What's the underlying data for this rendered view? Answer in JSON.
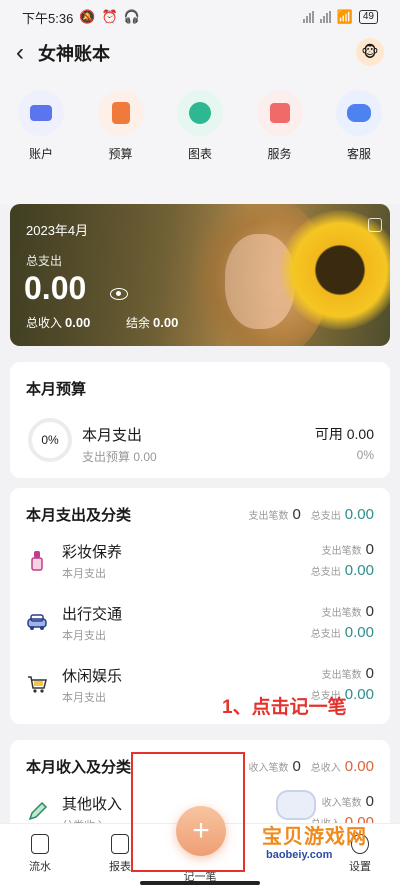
{
  "status": {
    "time": "下午5:36",
    "battery": "49"
  },
  "header": {
    "title": "女神账本"
  },
  "quick_actions": [
    {
      "label": "账户",
      "color": "#5b74f0",
      "bg": "#eef1fc"
    },
    {
      "label": "预算",
      "color": "#f07a3c",
      "bg": "#fdf0e8"
    },
    {
      "label": "图表",
      "color": "#2db892",
      "bg": "#e6f7f1"
    },
    {
      "label": "服务",
      "color": "#f06a6a",
      "bg": "#fdeeee"
    },
    {
      "label": "客服",
      "color": "#4d82f0",
      "bg": "#eaf0fd"
    }
  ],
  "banner": {
    "month": "2023年4月",
    "expense_label": "总支出",
    "expense": "0.00",
    "income_label": "总收入",
    "income": "0.00",
    "balance_label": "结余",
    "balance": "0.00"
  },
  "budget": {
    "title": "本月预算",
    "percent": "0%",
    "expense_title": "本月支出",
    "budget_label": "支出预算 0.00",
    "available": "可用 0.00",
    "available_pct": "0%"
  },
  "expense_section": {
    "title": "本月支出及分类",
    "count_label": "支出笔数",
    "count": "0",
    "total_label": "总支出",
    "total": "0.00",
    "rows": [
      {
        "name": "彩妆保养",
        "sub": "本月支出",
        "count_label": "支出笔数",
        "count": "0",
        "total_label": "总支出",
        "total": "0.00"
      },
      {
        "name": "出行交通",
        "sub": "本月支出",
        "count_label": "支出笔数",
        "count": "0",
        "total_label": "总支出",
        "total": "0.00"
      },
      {
        "name": "休闲娱乐",
        "sub": "本月支出",
        "count_label": "支出笔数",
        "count": "0",
        "total_label": "总支出",
        "total": "0.00"
      }
    ]
  },
  "income_section": {
    "title": "本月收入及分类",
    "count_label": "收入笔数",
    "count": "0",
    "total_label": "总收入",
    "total": "0.00",
    "rows": [
      {
        "name": "其他收入",
        "sub": "分类收入",
        "count_label": "收入笔数",
        "count": "0",
        "total_label": "总收入",
        "total": "0.00"
      }
    ]
  },
  "annotation": "1、点击记一笔",
  "tabs": [
    {
      "label": "流水"
    },
    {
      "label": "报表"
    },
    {
      "label": "记一笔"
    },
    {
      "label": "设置"
    }
  ],
  "watermark": {
    "main": "宝贝游戏网",
    "sub": "baobeiy.com"
  }
}
